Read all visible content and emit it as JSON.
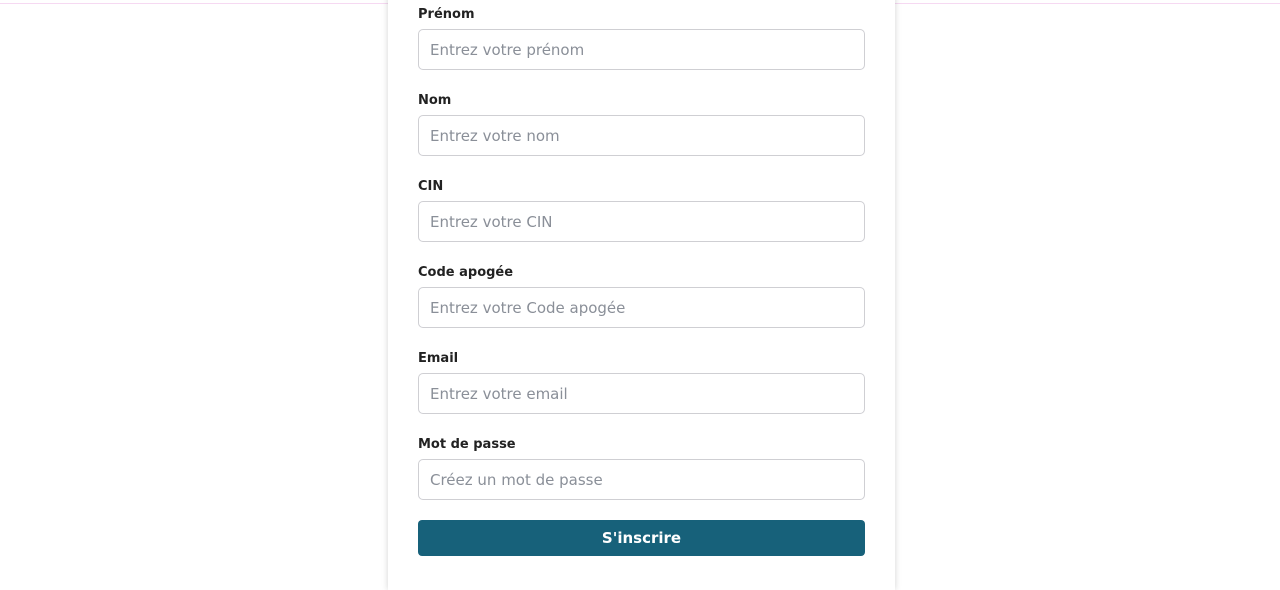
{
  "form": {
    "fields": [
      {
        "label": "Prénom",
        "placeholder": "Entrez votre prénom",
        "value": ""
      },
      {
        "label": "Nom",
        "placeholder": "Entrez votre nom",
        "value": ""
      },
      {
        "label": "CIN",
        "placeholder": "Entrez votre CIN",
        "value": ""
      },
      {
        "label": "Code apogée",
        "placeholder": "Entrez votre Code apogée",
        "value": ""
      },
      {
        "label": "Email",
        "placeholder": "Entrez votre email",
        "value": ""
      },
      {
        "label": "Mot de passe",
        "placeholder": "Créez un mot de passe",
        "value": ""
      }
    ],
    "submit_label": "S'inscrire"
  },
  "colors": {
    "button_bg": "#17617a",
    "button_text": "#ffffff",
    "input_border": "#cfcfd3",
    "label_text": "#222222",
    "placeholder_text": "#8a8f98"
  }
}
